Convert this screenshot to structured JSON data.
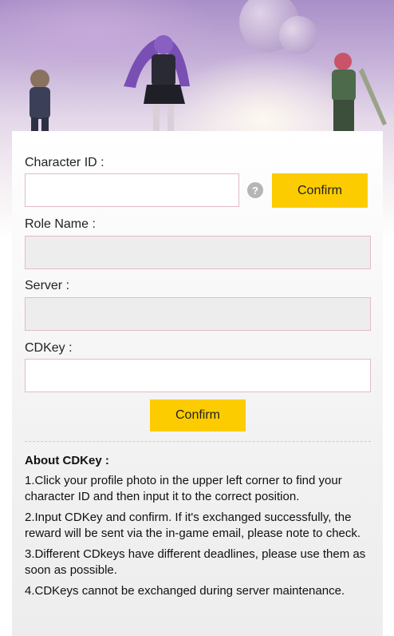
{
  "form": {
    "character_id_label": "Character ID :",
    "confirm_label": "Confirm",
    "role_name_label": "Role Name :",
    "server_label": "Server :",
    "cdkey_label": "CDKey :",
    "submit_label": "Confirm",
    "help_symbol": "?"
  },
  "about": {
    "title": "About CDKey :",
    "tips": [
      "1.Click your profile photo in the upper left corner to find your character ID and then input it to the correct position.",
      "2.Input CDKey and confirm. If it's exchanged successfully, the reward will be sent via the in-game email, please note to check.",
      "3.Different CDkeys have different deadlines, please use them as soon as possible.",
      "4.CDKeys cannot be exchanged during server maintenance."
    ]
  },
  "colors": {
    "accent": "#fccc00",
    "field_border": "#e2bcc4",
    "disabled_field": "#eeeded"
  }
}
